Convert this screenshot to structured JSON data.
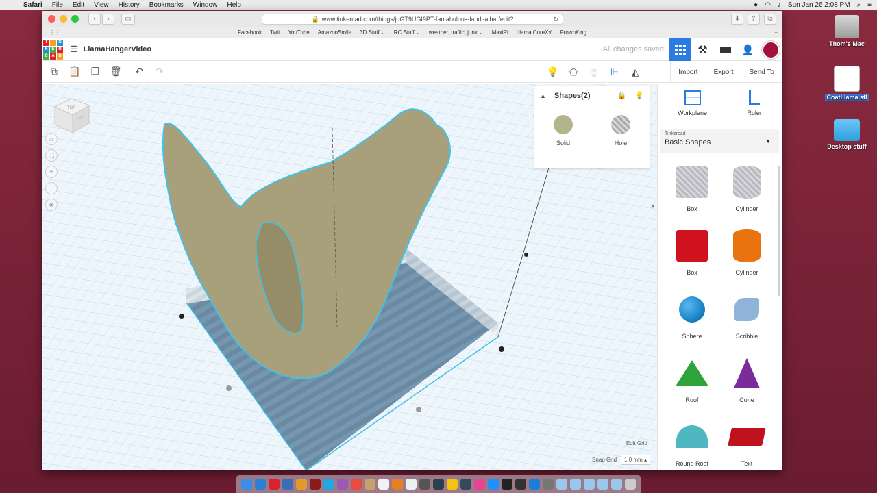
{
  "menubar": {
    "app": "Safari",
    "items": [
      "File",
      "Edit",
      "View",
      "History",
      "Bookmarks",
      "Window",
      "Help"
    ],
    "clock": "Sun Jan 26  2:08 PM",
    "user": "Thom's Mac"
  },
  "desktop_icons": [
    {
      "label": "Thom's Mac",
      "icon": "hard-drive-icon"
    },
    {
      "label": "CoatLlama.stl",
      "icon": "stl-file-icon"
    },
    {
      "label": "Desktop stuff",
      "icon": "folder-icon"
    }
  ],
  "browser": {
    "url": "www.tinkercad.com/things/jqGT9UGI9PT-fantabulous-lahdi-albar/edit?",
    "favorites": [
      "Facebook",
      "Twit",
      "YouTube",
      "AmazonSmile",
      "3D Stuff ⌄",
      "RC Stuff ⌄",
      "weather, traffic, junk ⌄",
      "MaxiPi",
      "Llama CoreXY",
      "FrownKing"
    ]
  },
  "tinkercad": {
    "logo_letters": [
      "T",
      "I",
      "N",
      "K",
      "E",
      "R",
      "C",
      "A",
      "D"
    ],
    "design_name": "LlamaHangerVideo",
    "save_status": "All changes saved",
    "toolbar": {
      "import": "Import",
      "export": "Export",
      "send_to": "Send To"
    },
    "inspector": {
      "title": "Shapes(2)",
      "solid": "Solid",
      "hole": "Hole"
    },
    "viewcube": {
      "top": "TOP",
      "left": "LEFT"
    },
    "grid": {
      "edit_grid": "Edit Grid",
      "snap_label": "Snap Grid",
      "snap_value": "1.0 mm ▴"
    },
    "sidebar": {
      "workplane": "Workplane",
      "ruler": "Ruler",
      "library_source": "Tinkercad",
      "library_name": "Basic Shapes",
      "shapes": [
        {
          "label": "Box",
          "color": "#c8c8cc"
        },
        {
          "label": "Cylinder",
          "color": "#c8c8cc"
        },
        {
          "label": "Box",
          "color": "#d0121e"
        },
        {
          "label": "Cylinder",
          "color": "#e8730f"
        },
        {
          "label": "Sphere",
          "color": "#1a86c8"
        },
        {
          "label": "Scribble",
          "color": "#8fb4d8"
        },
        {
          "label": "Roof",
          "color": "#2ea33a"
        },
        {
          "label": "Cone",
          "color": "#7a2c9a"
        },
        {
          "label": "Round Roof",
          "color": "#4fb7bf"
        },
        {
          "label": "Text",
          "color": "#c0121e"
        }
      ]
    }
  }
}
